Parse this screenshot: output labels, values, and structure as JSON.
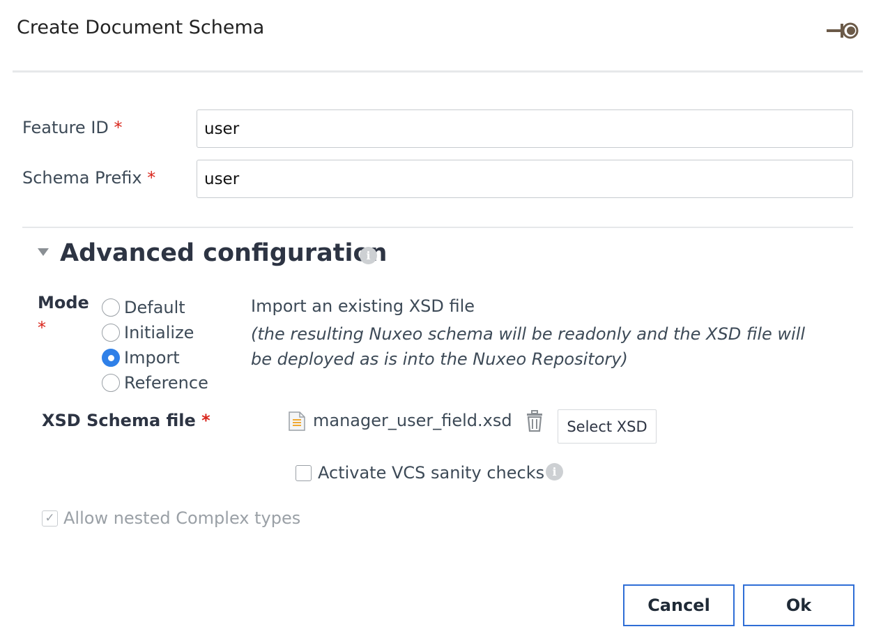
{
  "dialog": {
    "title": "Create Document Schema"
  },
  "form": {
    "feature_id": {
      "label": "Feature ID",
      "required_mark": "*",
      "value": "user"
    },
    "schema_prefix": {
      "label": "Schema Prefix",
      "required_mark": "*",
      "value": "user"
    }
  },
  "advanced": {
    "title": "Advanced configuration",
    "info_glyph": "i",
    "mode": {
      "label": "Mode",
      "required_mark": "*",
      "options": [
        "Default",
        "Initialize",
        "Import",
        "Reference"
      ],
      "selected": "Import",
      "description": "Import an existing XSD file",
      "note": "(the resulting Nuxeo schema will be readonly and the XSD file will be deployed as is into the Nuxeo Repository)"
    },
    "xsd": {
      "label": "XSD Schema file",
      "required_mark": "*",
      "file_name": "manager_user_field.xsd",
      "select_label": "Select XSD"
    },
    "vcs_checks": {
      "label": "Activate VCS sanity checks",
      "checked": false
    },
    "nested_types": {
      "label": "Allow nested Complex types",
      "checked": true,
      "disabled": true
    }
  },
  "footer": {
    "cancel_label": "Cancel",
    "ok_label": "Ok",
    "button_border": "#2f6ed6"
  },
  "colors": {
    "required": "#d9261c",
    "radio_selected": "#2f80e8"
  },
  "icons": [
    "pin-icon",
    "info-icon",
    "file-icon",
    "trash-icon",
    "caret-down-icon"
  ]
}
